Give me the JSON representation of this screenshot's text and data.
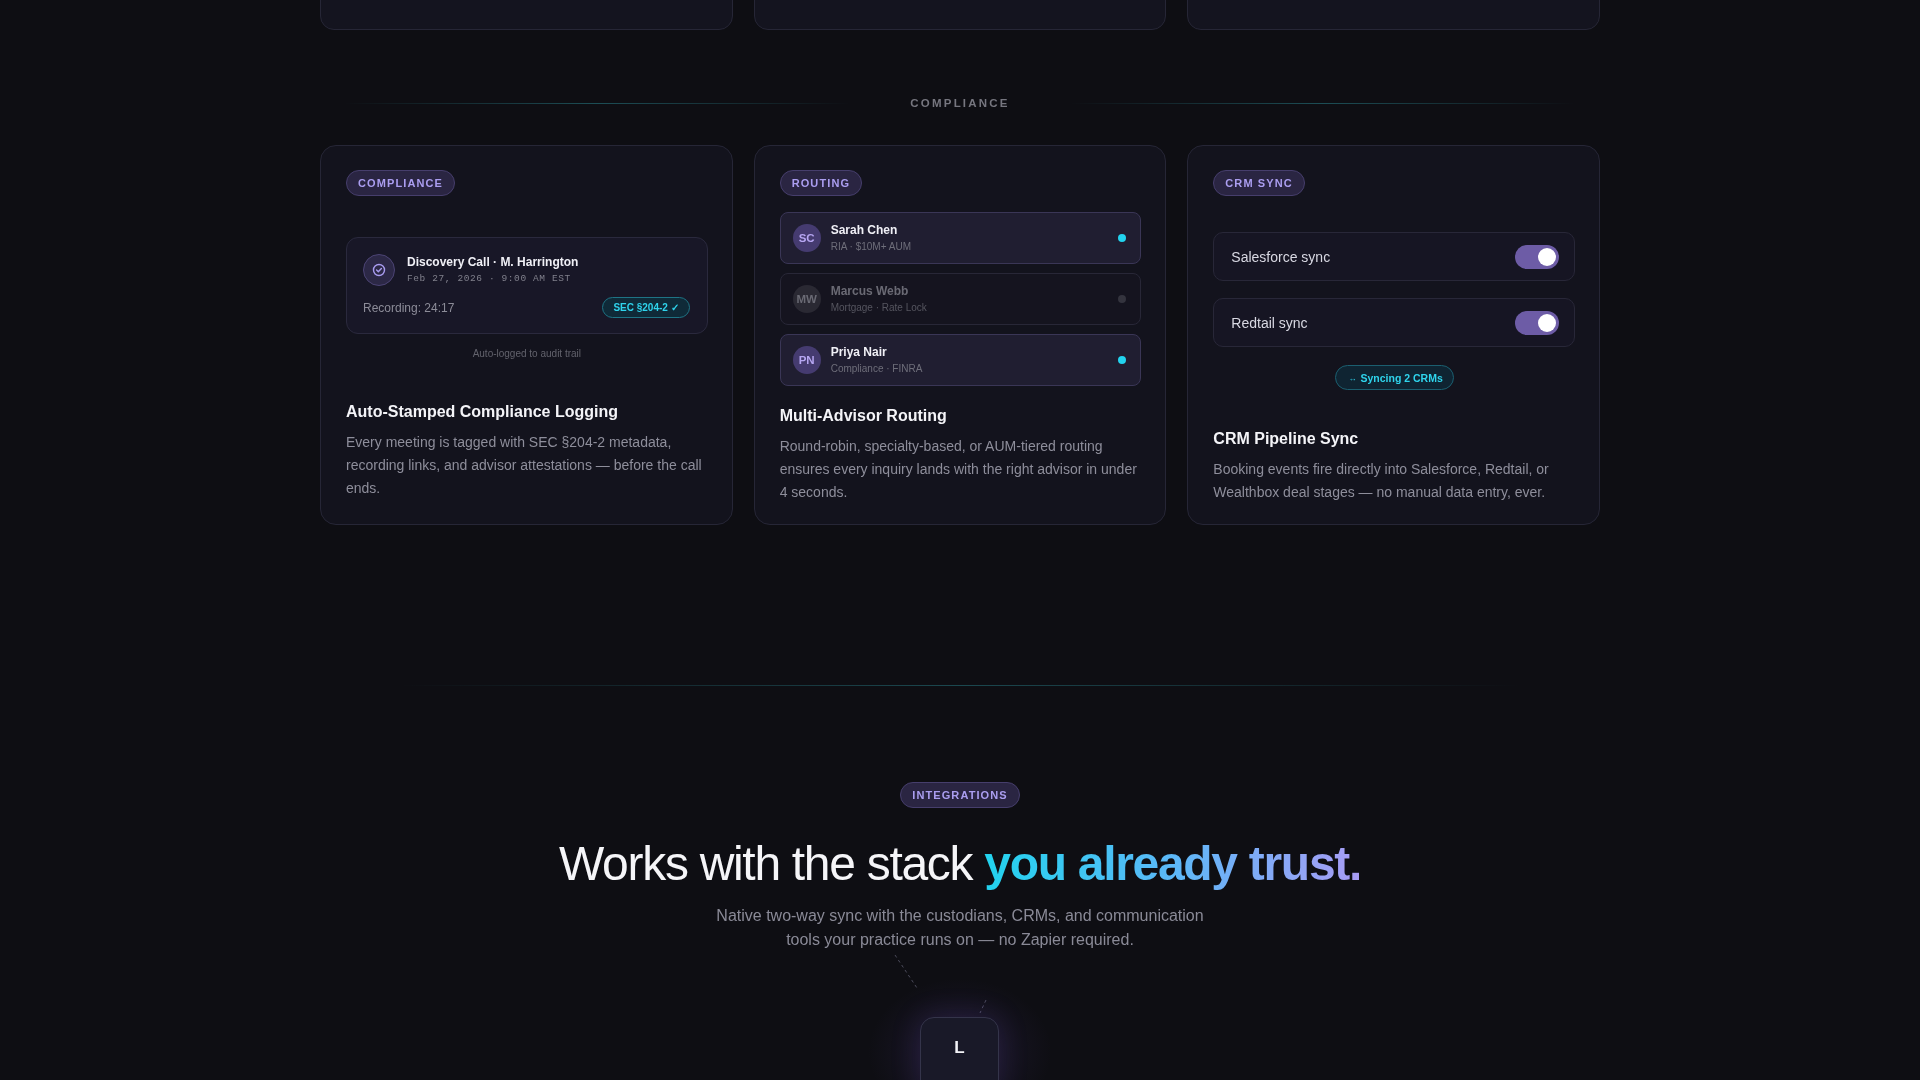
{
  "compliance_section": {
    "heading": "COMPLIANCE",
    "cards": [
      {
        "kind": "log",
        "badge": "COMPLIANCE",
        "log": {
          "title": "Discovery Call · M. Harrington",
          "meta": "Feb 27, 2026 · 9:00 AM EST",
          "recording": "Recording: 24:17",
          "tag": "SEC §204-2 ✓"
        },
        "caption": "Auto-logged to audit trail",
        "title": "Auto-Stamped Compliance Logging",
        "description": "Every meeting is tagged with SEC §204-2 metadata, recording links, and advisor attestations — before the call ends."
      },
      {
        "kind": "routing",
        "badge": "ROUTING",
        "advisors": [
          {
            "initials": "SC",
            "name": "Sarah Chen",
            "detail": "RIA · $10M+ AUM",
            "available": true
          },
          {
            "initials": "MW",
            "name": "Marcus Webb",
            "detail": "Mortgage · Rate Lock",
            "available": false
          },
          {
            "initials": "PN",
            "name": "Priya Nair",
            "detail": "Compliance · FINRA",
            "available": true
          }
        ],
        "title": "Multi-Advisor Routing",
        "description": "Round-robin, specialty-based, or AUM-tiered routing ensures every inquiry lands with the right advisor in under 4 seconds."
      },
      {
        "kind": "crm",
        "badge": "CRM SYNC",
        "toggles": [
          {
            "label": "Salesforce sync",
            "on": true
          },
          {
            "label": "Redtail sync",
            "on": true
          }
        ],
        "status_glyph": "↔",
        "status": "Syncing 2 CRMs",
        "title": "CRM Pipeline Sync",
        "description": "Booking events fire directly into Salesforce, Redtail, or Wealthbox deal stages — no manual data entry, ever."
      }
    ]
  },
  "integrations": {
    "badge": "INTEGRATIONS",
    "headline": "Works with the stack",
    "headline_highlight": "you already trust.",
    "subtitle": "Native two-way sync with the custodians, CRMs, and communication tools your practice runs on — no Zapier required.",
    "hub": {
      "label": "L"
    }
  }
}
